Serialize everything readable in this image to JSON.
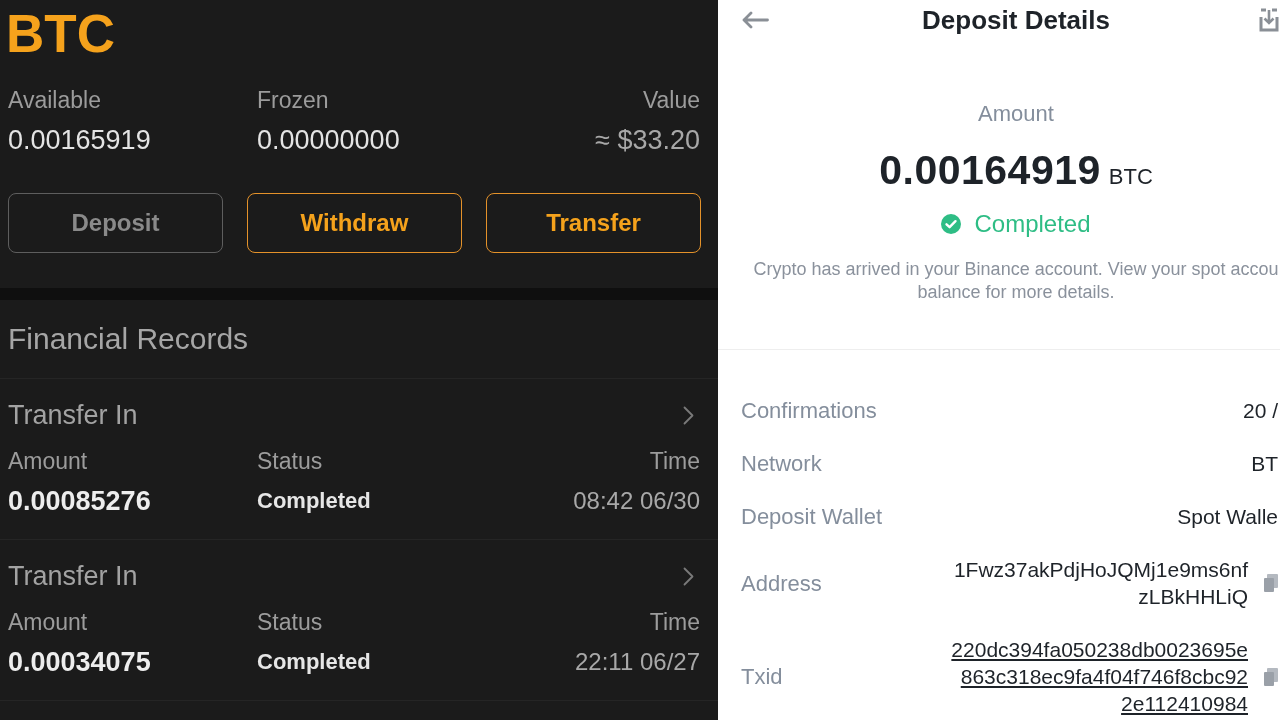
{
  "asset": {
    "coin": "BTC",
    "balances": [
      {
        "label": "Available",
        "value": "0.00165919"
      },
      {
        "label": "Frozen",
        "value": "0.00000000"
      },
      {
        "label": "Value",
        "value": "≈ $33.20"
      }
    ],
    "actions": [
      {
        "label": "Deposit",
        "disabled": true
      },
      {
        "label": "Withdraw",
        "disabled": false
      },
      {
        "label": "Transfer",
        "disabled": false
      }
    ]
  },
  "records": {
    "title": "Financial Records",
    "items": [
      {
        "type": "Transfer In",
        "fields": [
          {
            "label": "Amount",
            "value": "0.00085276"
          },
          {
            "label": "Status",
            "value": "Completed"
          },
          {
            "label": "Time",
            "value": "08:42 06/30"
          }
        ]
      },
      {
        "type": "Transfer In",
        "fields": [
          {
            "label": "Amount",
            "value": "0.00034075"
          },
          {
            "label": "Status",
            "value": "Completed"
          },
          {
            "label": "Time",
            "value": "22:11 06/27"
          }
        ]
      }
    ]
  },
  "details": {
    "title": "Deposit Details",
    "amount_label": "Amount",
    "amount": "0.00164919",
    "unit": "BTC",
    "status": "Completed",
    "description_lines": [
      "Crypto has arrived in your Binance account. View your spot accou",
      "balance for more details."
    ],
    "rows": [
      {
        "label": "Confirmations",
        "kind": "text",
        "copyable": false,
        "lines": [
          "20 /"
        ]
      },
      {
        "label": "Network",
        "kind": "text",
        "copyable": false,
        "lines": [
          "BT"
        ]
      },
      {
        "label": "Deposit Wallet",
        "kind": "text",
        "copyable": false,
        "lines": [
          "Spot Walle"
        ]
      },
      {
        "label": "Address",
        "kind": "text",
        "copyable": true,
        "lines": [
          "1Fwz37akPdjHoJQMj1e9ms6nf",
          "zLBkHHLiQ"
        ]
      },
      {
        "label": "Txid",
        "kind": "link",
        "copyable": true,
        "lines": [
          "220dc394fa050238db0023695e",
          "863c318ec9fa4f04f746f8cbc92",
          "2e112410984"
        ]
      }
    ]
  }
}
